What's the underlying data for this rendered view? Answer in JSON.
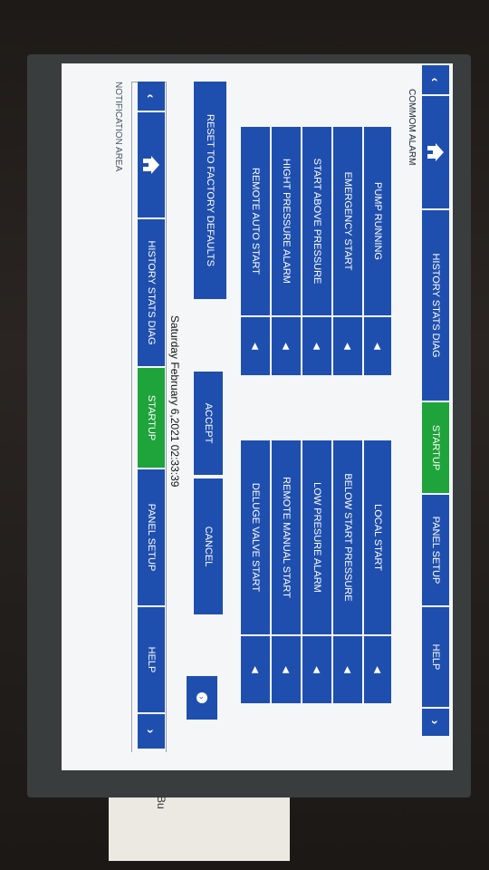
{
  "nav": {
    "back_icon": "chevron-left-icon",
    "home_icon": "home-icon",
    "tabs": [
      "HISTORY STATS DIAG",
      "STARTUP",
      "PANEL SETUP",
      "HELP"
    ],
    "forward_icon": "chevron-right-icon"
  },
  "section_title": "COMMOM ALARM",
  "left_options": [
    "PUMP RUNNING",
    "EMERGENCY START",
    "START ABOVE PRESSURE",
    "HIGHT PRESSURE ALARM",
    "REMOTE AUTO START"
  ],
  "right_options": [
    "LOCAL START",
    "BELOW START PRESSURE",
    "LOW PRESURE ALARM",
    "REMOTE MANUAL START",
    "DELUGE VALVE START"
  ],
  "dropdown_icon": "caret-icon",
  "actions": {
    "reset": "RESET TO FACTORY DEFAULTS",
    "accept": "ACCEPT",
    "cancel": "CANCEL",
    "info_icon": "circle-arrow-icon"
  },
  "status": {
    "datetime": "Saturday February 6,2021 02:33:39"
  },
  "notification_label": "NOTIFICATION AREA",
  "colors": {
    "button_blue": "#1f4fae",
    "active_green": "#1ea43a"
  },
  "device_label": "Bu"
}
